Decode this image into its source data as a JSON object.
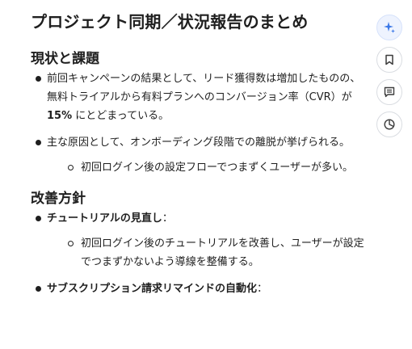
{
  "document": {
    "title": "プロジェクト同期／状況報告のまとめ",
    "section1": {
      "heading": "現状と課題",
      "bullets": [
        {
          "before": "前回キャンペーンの結果として、リード獲得数は増加したものの、無料トライアルから有料プランへのコンバージョン率（CVR）が ",
          "bold": "15%",
          "after": " にとどまっている。"
        },
        {
          "text": "主な原因として、オンボーディング段階での離脱が挙げられる。",
          "sub": [
            "初回ログイン後の設定フローでつまずくユーザーが多い。"
          ]
        }
      ]
    },
    "section2": {
      "heading": "改善方針",
      "bullets": [
        {
          "bold": "チュートリアルの見直し",
          "after": "：",
          "sub": [
            "初回ログイン後のチュートリアルを改善し、ユーザーが設定でつまずかないよう導線を整備する。"
          ]
        },
        {
          "bold": "サブスクリプション請求リマインドの自動化",
          "after": "："
        }
      ]
    }
  },
  "rail": {
    "icons": [
      "sparkle-icon",
      "bookmark-icon",
      "comment-icon",
      "pie-chart-icon"
    ],
    "accent_color": "#3b78e7"
  }
}
